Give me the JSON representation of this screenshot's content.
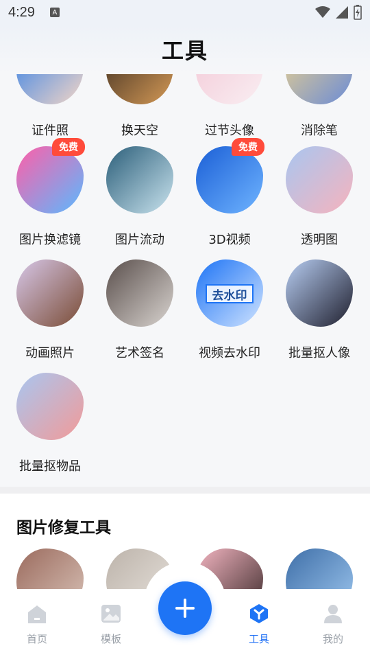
{
  "status_bar": {
    "time": "4:29",
    "badge": "A"
  },
  "header": {
    "title": "工具"
  },
  "tools_rows": [
    [
      {
        "label": "证件照",
        "icon": "id-photo-icon",
        "colors": [
          "#2f7ee8",
          "#f4d6c6"
        ]
      },
      {
        "label": "换天空",
        "icon": "sky-replace-icon",
        "colors": [
          "#3a2b20",
          "#d59a56"
        ]
      },
      {
        "label": "过节头像",
        "icon": "holiday-avatar-icon",
        "colors": [
          "#f3c8d6",
          "#f9eef2"
        ]
      },
      {
        "label": "消除笔",
        "icon": "eraser-pen-icon",
        "colors": [
          "#f0d48b",
          "#6a8bd6"
        ]
      }
    ],
    [
      {
        "label": "图片换滤镜",
        "icon": "filter-icon",
        "badge": "免费",
        "colors": [
          "#ff5fa8",
          "#5ab9ff"
        ]
      },
      {
        "label": "图片流动",
        "icon": "waterfall-icon",
        "colors": [
          "#2c5f7a",
          "#c9e3ee"
        ]
      },
      {
        "label": "3D视频",
        "icon": "3d-video-icon",
        "badge": "免费",
        "colors": [
          "#1b5fd6",
          "#6fb4ff"
        ]
      },
      {
        "label": "透明图",
        "icon": "transparent-icon",
        "colors": [
          "#a9c6f0",
          "#f6b3bd"
        ]
      }
    ],
    [
      {
        "label": "动画照片",
        "icon": "cartoon-photo-icon",
        "colors": [
          "#d7c7e8",
          "#7a4c35"
        ]
      },
      {
        "label": "艺术签名",
        "icon": "art-signature-icon",
        "colors": [
          "#5a4f4c",
          "#d9d4d0"
        ]
      },
      {
        "label": "视频去水印",
        "icon": "remove-watermark-icon",
        "watermark_text": "去水印",
        "colors": [
          "#1e74f5",
          "#cfe3ff"
        ]
      },
      {
        "label": "批量抠人像",
        "icon": "batch-portrait-icon",
        "colors": [
          "#b7cdf2",
          "#1f1f2e"
        ]
      }
    ],
    [
      {
        "label": "批量抠物品",
        "icon": "batch-object-icon",
        "colors": [
          "#a9c6f0",
          "#f29a98"
        ]
      }
    ]
  ],
  "repair_section": {
    "title": "图片修复工具",
    "thumbs": [
      {
        "icon": "repair-portrait-1-icon",
        "colors": [
          "#9b6b5e",
          "#d9c3b8"
        ]
      },
      {
        "icon": "repair-portrait-2-icon",
        "colors": [
          "#bcb3aa",
          "#e9e4de"
        ]
      },
      {
        "icon": "repair-portrait-3-icon",
        "colors": [
          "#f4b6c2",
          "#3b2a2a"
        ]
      },
      {
        "icon": "repair-scene-icon",
        "colors": [
          "#3f6fa8",
          "#9ec7ef"
        ]
      }
    ]
  },
  "tabbar": {
    "items": [
      {
        "label": "首页",
        "icon": "home-icon",
        "active": false
      },
      {
        "label": "模板",
        "icon": "template-icon",
        "active": false
      },
      {
        "label": "工具",
        "icon": "tools-icon",
        "active": true
      },
      {
        "label": "我的",
        "icon": "profile-icon",
        "active": false
      }
    ],
    "fab_icon": "plus-icon"
  },
  "colors": {
    "accent": "#1e74f5",
    "badge": "#ff4b3b",
    "inactive": "#9aa0a8"
  }
}
